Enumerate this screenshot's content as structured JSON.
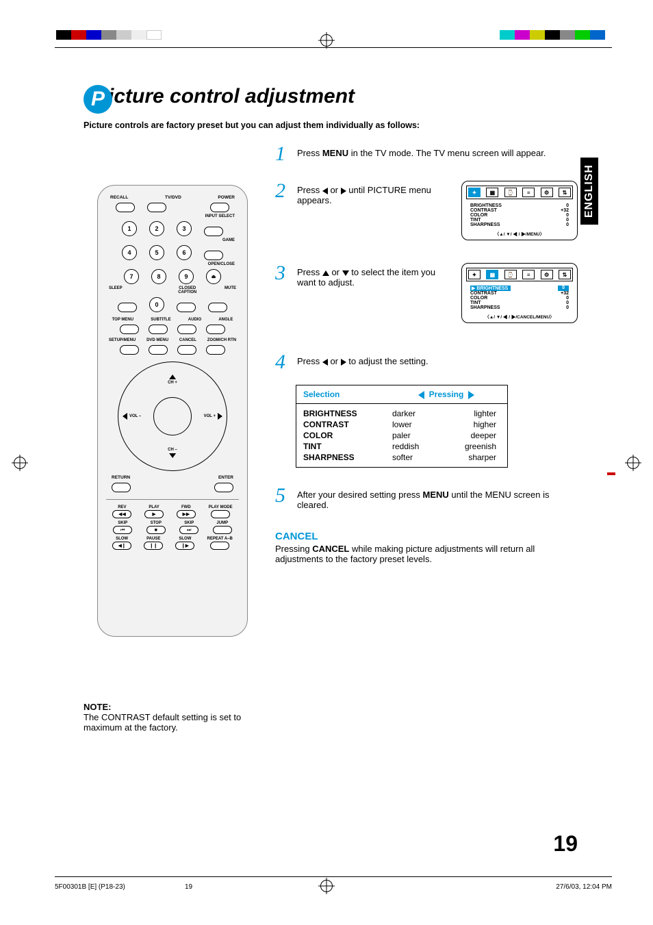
{
  "domain": "Document",
  "heading": {
    "circle": "P",
    "title": "icture control adjustment"
  },
  "subheading": "Picture controls are factory preset but you can adjust them individually as follows:",
  "language_tab": "ENGLISH",
  "remote": {
    "row1": [
      "RECALL",
      "TV/DVD",
      "POWER"
    ],
    "input_select": "INPUT SELECT",
    "game": "GAME",
    "open_close": "OPEN/CLOSE",
    "sleep": "SLEEP",
    "closed_caption": "CLOSED\nCAPTION",
    "mute": "MUTE",
    "row_menu": [
      "TOP MENU",
      "SUBTITLE",
      "AUDIO",
      "ANGLE"
    ],
    "row_setup": [
      "SETUP/MENU",
      "DVD MENU",
      "CANCEL",
      "ZOOM/CH RTN"
    ],
    "dpad": {
      "ch_up": "CH +",
      "ch_down": "CH –",
      "vol_down": "VOL –",
      "vol_up": "VOL +"
    },
    "return": "RETURN",
    "enter": "ENTER",
    "transport1": [
      "REV",
      "PLAY",
      "FWD",
      "PLAY MODE"
    ],
    "transport2": [
      "SKIP",
      "STOP",
      "SKIP",
      "JUMP"
    ],
    "transport3": [
      "SLOW",
      "PAUSE",
      "SLOW",
      "REPEAT A–B"
    ],
    "numbers": [
      "1",
      "2",
      "3",
      "4",
      "5",
      "6",
      "7",
      "8",
      "9",
      "0"
    ]
  },
  "steps": {
    "s1": {
      "num": "1",
      "pre": "Press ",
      "b": "MENU",
      "post": " in the TV mode. The TV menu screen will appear."
    },
    "s2": {
      "num": "2",
      "pre": "Press ",
      "mid": " or ",
      "post": " until PICTURE menu appears."
    },
    "s3": {
      "num": "3",
      "pre": "Press ",
      "mid": " or ",
      "post": " to select the item you want to adjust."
    },
    "s4": {
      "num": "4",
      "pre": "Press ",
      "mid": " or ",
      "post": " to adjust the setting."
    },
    "s5": {
      "num": "5",
      "pre": "After your desired setting press ",
      "b": "MENU",
      "post": " until the MENU screen is cleared."
    }
  },
  "tv_menu": {
    "items": [
      {
        "label": "BRIGHTNESS",
        "value": "0"
      },
      {
        "label": "CONTRAST",
        "value": "+32"
      },
      {
        "label": "COLOR",
        "value": "0"
      },
      {
        "label": "TINT",
        "value": "0"
      },
      {
        "label": "SHARPNESS",
        "value": "0"
      }
    ],
    "nav1": "▲/ ▼/ ◀ / ▶/MENU",
    "nav2": "▲/ ▼/ ◀ / ▶/CANCEL/MENU"
  },
  "selection_table": {
    "hdr1": "Selection",
    "hdr2": "Pressing",
    "rows": [
      {
        "name": "BRIGHTNESS",
        "left": "darker",
        "right": "lighter"
      },
      {
        "name": "CONTRAST",
        "left": "lower",
        "right": "higher"
      },
      {
        "name": "COLOR",
        "left": "paler",
        "right": "deeper"
      },
      {
        "name": "TINT",
        "left": "reddish",
        "right": "greenish"
      },
      {
        "name": "SHARPNESS",
        "left": "softer",
        "right": "sharper"
      }
    ]
  },
  "cancel": {
    "title": "CANCEL",
    "pre": "Pressing ",
    "b": "CANCEL",
    "post": " while making picture adjustments will return all adjustments to the factory preset levels."
  },
  "note": {
    "title": "NOTE:",
    "text": "The CONTRAST default setting is set to maximum at the factory."
  },
  "page_number": "19",
  "footer": {
    "file": "5F00301B [E] (P18-23)",
    "page": "19",
    "date": "27/6/03, 12:04 PM"
  },
  "print_colors_left": [
    "#000",
    "#c00",
    "#00c",
    "#888",
    "#ccc",
    "#eee",
    "#fff"
  ],
  "print_colors_right": [
    "#0cc",
    "#c0c",
    "#cc0",
    "#000",
    "#888",
    "#0c0",
    "#06c"
  ]
}
